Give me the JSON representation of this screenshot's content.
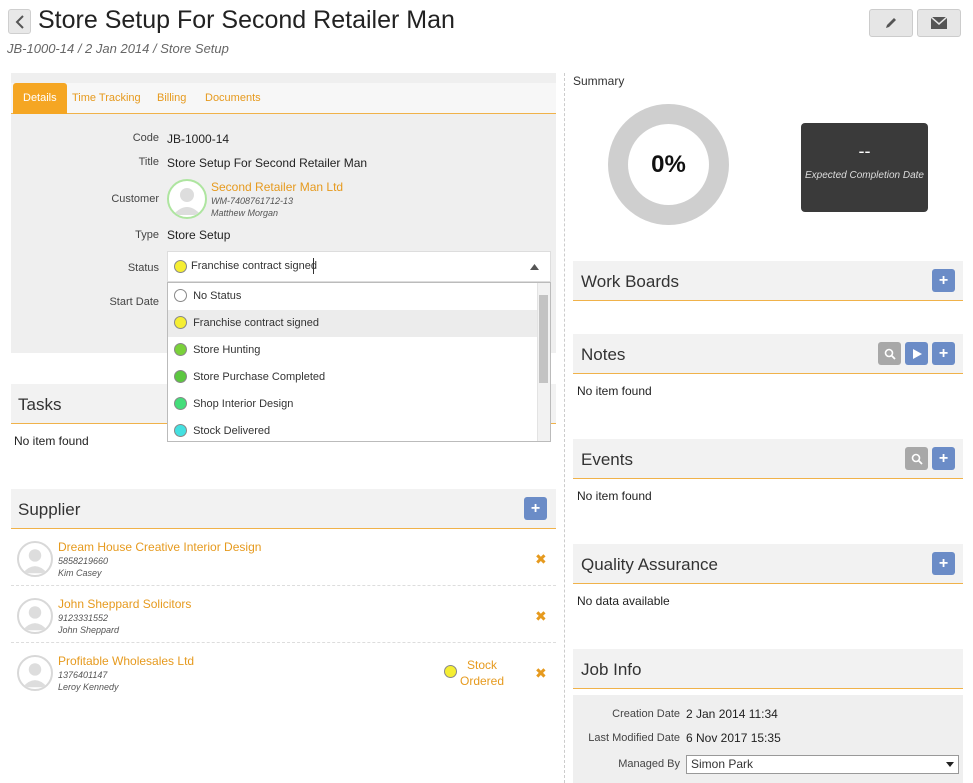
{
  "header": {
    "title": "Store Setup For Second Retailer Man",
    "breadcrumb": "JB-1000-14 / 2 Jan 2014 / Store Setup",
    "icons": {
      "back": "chevron-left-icon",
      "edit": "pencil-icon",
      "email": "envelope-icon"
    }
  },
  "tabs": [
    "Details",
    "Time Tracking",
    "Billing",
    "Documents"
  ],
  "details": {
    "code_label": "Code",
    "code": "JB-1000-14",
    "title_label": "Title",
    "title": "Store Setup For Second Retailer Man",
    "customer_label": "Customer",
    "customer": {
      "name": "Second Retailer Man Ltd",
      "ref": "WM-7408761712-13",
      "contact": "Matthew Morgan"
    },
    "type_label": "Type",
    "type": "Store Setup",
    "status_label": "Status",
    "status": "Franchise contract signed",
    "start_date_label": "Start Date"
  },
  "status_options": [
    {
      "label": "No Status",
      "color": "#ffffff"
    },
    {
      "label": "Franchise contract signed",
      "color": "#f5ee33"
    },
    {
      "label": "Store Hunting",
      "color": "#7ad13a"
    },
    {
      "label": "Store Purchase Completed",
      "color": "#5cc740"
    },
    {
      "label": "Shop Interior Design",
      "color": "#44dd7a"
    },
    {
      "label": "Stock Delivered",
      "color": "#44e0e0"
    }
  ],
  "tasks": {
    "title": "Tasks",
    "empty": "No item found"
  },
  "supplier": {
    "title": "Supplier",
    "items": [
      {
        "name": "Dream House Creative Interior Design",
        "phone": "5858219660",
        "contact": "Kim Casey"
      },
      {
        "name": "John Sheppard Solicitors",
        "phone": "9123331552",
        "contact": "John Sheppard"
      },
      {
        "name": "Profitable Wholesales Ltd",
        "phone": "1376401147",
        "contact": "Leroy Kennedy",
        "status_line1": "Stock",
        "status_line2": "Ordered",
        "status_color": "#f5ee33"
      }
    ]
  },
  "summary": {
    "label": "Summary",
    "percent": "0%",
    "ecd_value": "--",
    "ecd_label": "Expected Completion Date"
  },
  "work_boards": {
    "title": "Work Boards"
  },
  "notes": {
    "title": "Notes",
    "empty": "No item found"
  },
  "events": {
    "title": "Events",
    "empty": "No item found"
  },
  "qa": {
    "title": "Quality Assurance",
    "empty": "No data available"
  },
  "job_info": {
    "title": "Job Info",
    "creation_label": "Creation Date",
    "creation": "2 Jan 2014 11:34",
    "modified_label": "Last Modified Date",
    "modified": "6 Nov 2017 15:35",
    "managed_label": "Managed By",
    "managed": "Simon Park"
  },
  "colors": {
    "accent": "#f5a623",
    "link": "#e69a1e",
    "blue_button": "#6b8cc7"
  }
}
